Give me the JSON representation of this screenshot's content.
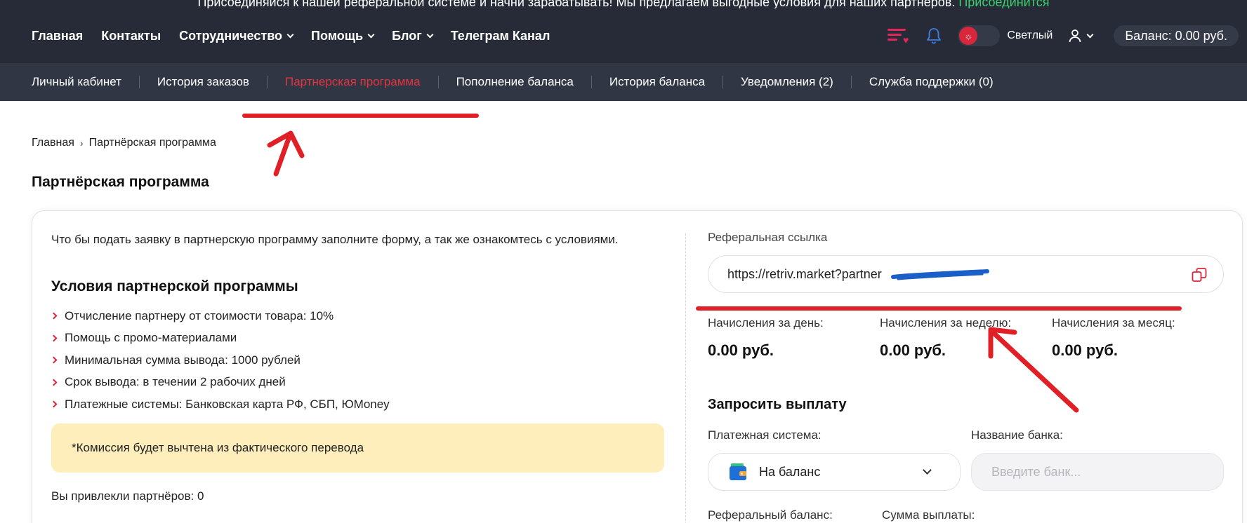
{
  "announcement": {
    "text": "Присоединяйся к нашей реферальной системе и начни зарабатывать! Мы предлагаем выгодные условия для наших партнеров.",
    "link": "Присоединится",
    "link_color": "#3ccf6b"
  },
  "main_nav": {
    "items": [
      {
        "label": "Главная",
        "dropdown": false
      },
      {
        "label": "Контакты",
        "dropdown": false
      },
      {
        "label": "Сотрудничество",
        "dropdown": true
      },
      {
        "label": "Помощь",
        "dropdown": true
      },
      {
        "label": "Блог",
        "dropdown": true
      },
      {
        "label": "Телеграм Канал",
        "dropdown": false
      }
    ],
    "theme_label": "Светлый",
    "balance": "Баланс: 0.00 руб."
  },
  "sub_nav": {
    "items": [
      {
        "label": "Личный кабинет",
        "active": false
      },
      {
        "label": "История заказов",
        "active": false
      },
      {
        "label": "Партнерская программа",
        "active": true
      },
      {
        "label": "Пополнение баланса",
        "active": false
      },
      {
        "label": "История баланса",
        "active": false
      },
      {
        "label": "Уведомления (2)",
        "active": false
      },
      {
        "label": "Служба поддержки (0)",
        "active": false
      }
    ],
    "active_color": "#e3343e"
  },
  "breadcrumb": {
    "home": "Главная",
    "separator": "›",
    "current": "Партнёрская программа"
  },
  "page_title": "Партнёрская программа",
  "left": {
    "intro": "Что бы подать заявку в партнерскую программу заполните форму, а так же ознакомтесь с условиями.",
    "conditions_title": "Условия партнерской программы",
    "conditions": [
      "Отчисление партнеру от стоимости товара: 10%",
      "Помощь с промо-материалами",
      "Минимальная сумма вывода: 1000 рублей",
      "Срок вывода: в течении 2 рабочих дней",
      "Платежные системы: Банковская карта РФ, СБП, ЮMoney"
    ],
    "notice": "*Комиссия будет вычтена из фактического перевода",
    "attracted": "Вы привлекли партнёров: 0"
  },
  "right": {
    "ref_label": "Реферальная ссылка",
    "ref_link": "https://retriv.market?partner",
    "stats": [
      {
        "label": "Начисления за день:",
        "value": "0.00 руб."
      },
      {
        "label": "Начисления за неделю:",
        "value": "0.00 руб."
      },
      {
        "label": "Начисления за месяц:",
        "value": "0.00 руб."
      }
    ],
    "payout_title": "Запросить выплату",
    "payment_system_label": "Платежная система:",
    "payment_system_value": "На баланс",
    "bank_label": "Название банка:",
    "bank_placeholder": "Введите банк...",
    "ref_balance_label": "Реферальный баланс:",
    "payout_amount_label": "Сумма выплаты:"
  },
  "colors": {
    "nav_bg": "#262b37",
    "subnav_bg": "#303644",
    "accent_red": "#d8263b",
    "notice_bg": "#fdeebc",
    "annotation_red": "#e11f26",
    "redaction_blue": "#1a5ec8"
  }
}
